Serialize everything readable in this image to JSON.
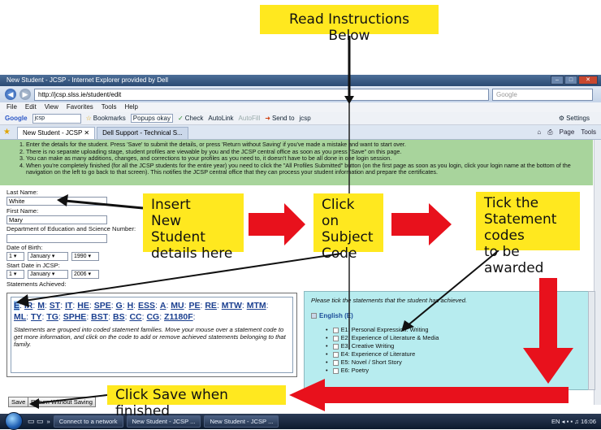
{
  "annotations": {
    "read_instructions": "Read Instructions Below",
    "insert_details_l1": "Insert",
    "insert_details_l2": "New Student",
    "insert_details_l3": "details here",
    "click_subject_l1": "Click on",
    "click_subject_l2": "Subject",
    "click_subject_l3": "Code",
    "tick_statement_l1": "Tick the",
    "tick_statement_l2": "Statement codes",
    "tick_statement_l3": "to be awarded",
    "click_save": "Click Save when finished"
  },
  "browser": {
    "window_title": "New Student - JCSP - Internet Explorer provided by Dell",
    "url": "http://jcsp.slss.ie/student/edit",
    "search_placeholder": "Google",
    "menu": [
      "File",
      "Edit",
      "View",
      "Favorites",
      "Tools",
      "Help"
    ],
    "google_toolbar": {
      "search_value": "jcsp",
      "items": [
        "Bookmarks",
        "Popups okay",
        "Check",
        "AutoLink",
        "AutoFill",
        "Send to",
        "jcsp"
      ],
      "settings": "Settings"
    },
    "tabs": [
      {
        "label": "New Student - JCSP"
      },
      {
        "label": "Dell Support - Technical S..."
      }
    ],
    "tab_tools": [
      "Page",
      "Tools"
    ]
  },
  "instructions": [
    "Enter the details for the student. Press 'Save' to submit the details, or press 'Return without Saving' if you've made a mistake and want to start over.",
    "There is no separate uploading stage, student profiles are viewable by you and the JCSP central office as soon as you press \"Save\" on this page.",
    "You can make as many additions, changes, and corrections to your profiles as you need to, it doesn't have to be all done in one login session.",
    "When you're completely finished (for all the JCSP students for the entire year) you need to click the \"All Profiles Submitted\" button (on the first page as soon as you login, click your login name at the bottom of the navigation on the left to go back to that screen). This notifies the JCSP central office that they can process your student information and prepare the certificates."
  ],
  "form": {
    "last_name_label": "Last Name:",
    "last_name_value": "White",
    "first_name_label": "First Name:",
    "first_name_value": "Mary",
    "dept_label": "Department of Education and Science Number:",
    "dept_value": "",
    "dob_label": "Date of Birth:",
    "dob_day": "1",
    "dob_month": "January",
    "dob_year": "1990",
    "start_label": "Start Date in JCSP:",
    "start_day": "1",
    "start_month": "January",
    "start_year": "2006",
    "statements_label": "Statements Achieved:"
  },
  "codes": {
    "line1": [
      "E",
      "IR",
      "M",
      "ST",
      "IT",
      "HE",
      "SPE",
      "G",
      "H",
      "ESS",
      "A",
      "MU",
      "PE",
      "RE",
      "MTW",
      "MTM"
    ],
    "line2": [
      "ML",
      "TY",
      "TG",
      "SPHE",
      "BST",
      "BS",
      "CC",
      "CG",
      "Z1180F"
    ],
    "note": "Statements are grouped into coded statement families. Move your mouse over a statement code to get more information, and click on the code to add or remove achieved statements belonging to that family."
  },
  "statements": {
    "prompt": "Please tick the statements that the student has achieved.",
    "family": "English (E)",
    "items": [
      "E1: Personal Expression: Writing",
      "E2: Experience of Literature & Media",
      "E3: Creative Writing",
      "E4: Experience of Literature",
      "E5: Novel / Short Story",
      "E6: Poetry"
    ]
  },
  "buttons": {
    "save": "Save",
    "return": "Return Without Saving"
  },
  "taskbar": {
    "items": [
      "Connect to a network",
      "New Student - JCSP ...",
      "New Student - JCSP ..."
    ],
    "lang": "EN",
    "clock": "16:06"
  },
  "colors": {
    "callout": "#ffe81f",
    "instructions_bg": "#a8d49c",
    "statements_bg": "#b7ecef",
    "arrow_red": "#e8111c"
  }
}
